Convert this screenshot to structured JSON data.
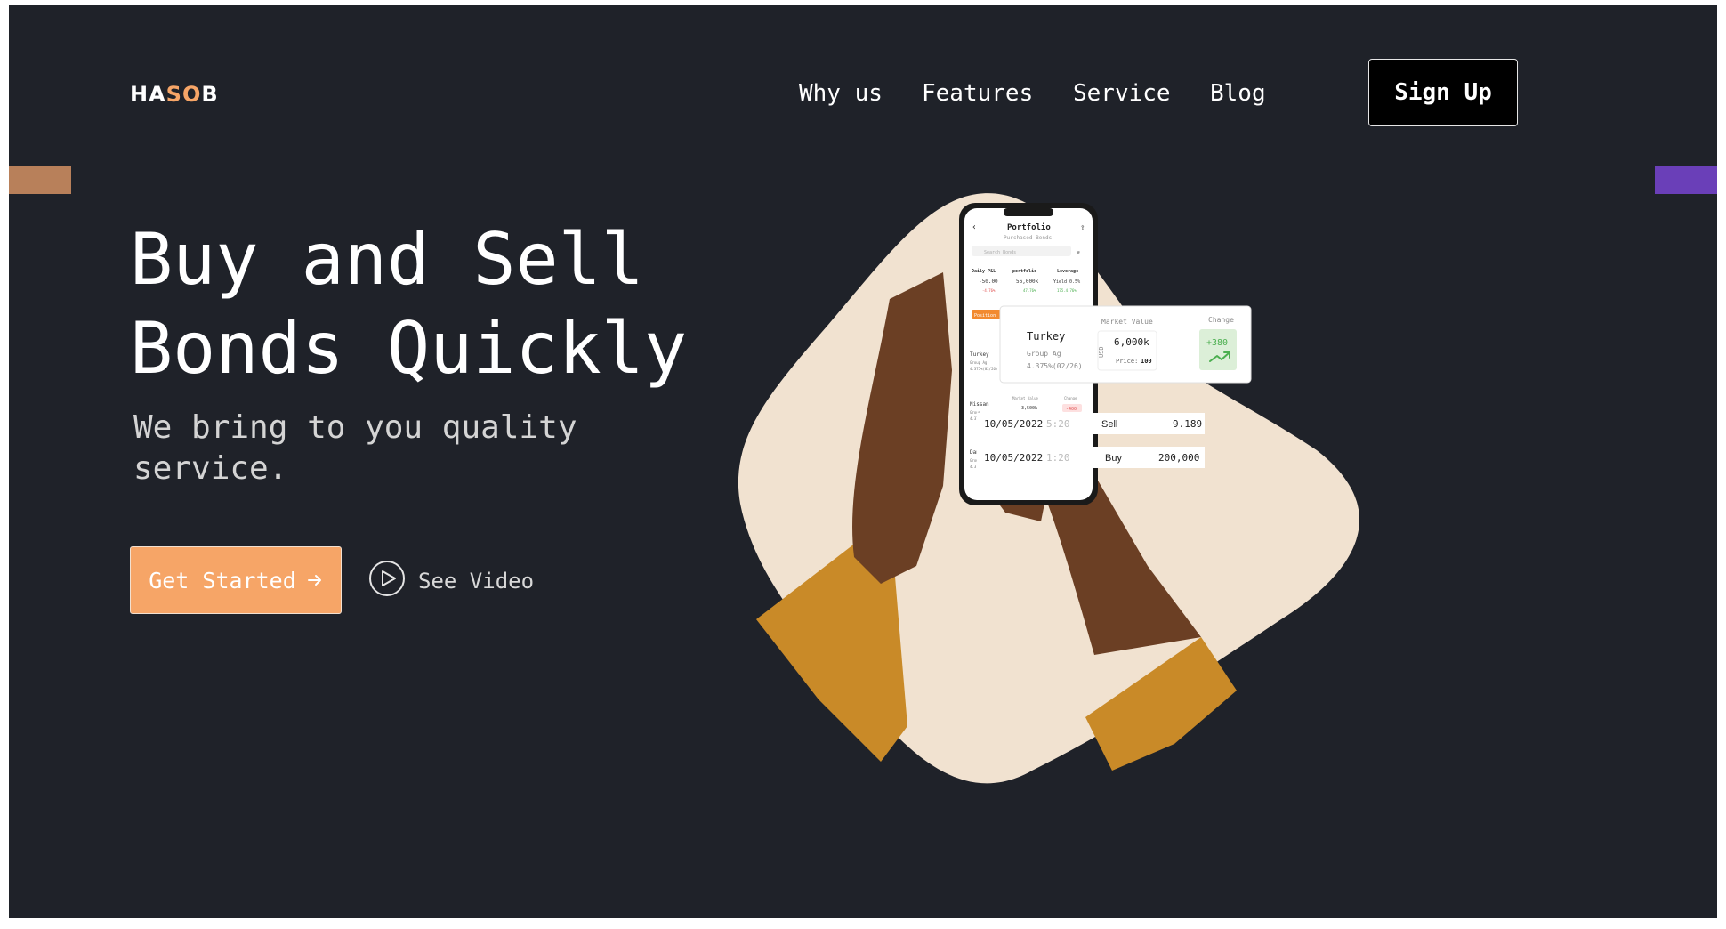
{
  "brand": {
    "logo_part1": "HA",
    "logo_part2": "SO",
    "logo_part3": "B"
  },
  "nav": {
    "items": [
      {
        "label": "Why us"
      },
      {
        "label": "Features"
      },
      {
        "label": "Service"
      },
      {
        "label": "Blog"
      }
    ],
    "signup_label": "Sign Up"
  },
  "hero": {
    "headline_line1": "Buy and Sell",
    "headline_line2": "Bonds Quickly",
    "subtitle": "We bring to you quality service.",
    "cta_label": "Get Started",
    "cta_icon": "arrow-right-icon",
    "video_label": "See Video",
    "video_icon": "play-circle-icon"
  },
  "phone": {
    "title": "Portfolio",
    "subtitle": "Purchased Bonds",
    "search_placeholder": "Search Bonds",
    "stats": [
      {
        "label": "Daily P&L",
        "value": "-50.00",
        "delta": "-4.76%"
      },
      {
        "label": "portfolio",
        "value": "56,000k",
        "delta": "47.76%"
      },
      {
        "label": "Leverage",
        "value": "Yield 0.5%",
        "delta": "175.4.76%"
      }
    ],
    "tab_label": "Position",
    "rows": [
      {
        "name": "Turkey",
        "detail": "Group Ag",
        "rate": "4.375%(02/26)"
      },
      {
        "name": "Nissan",
        "detail": "Group",
        "rate": "4.37",
        "value": "3,500k",
        "change": "-400"
      },
      {
        "name": "Dan",
        "detail": "Grou",
        "rate": "4.3"
      }
    ],
    "row_label_market": "Market Value",
    "row_label_change": "Change"
  },
  "popup": {
    "name": "Turkey",
    "group": "Group Ag",
    "rate": "4.375%(02/26)",
    "market_label": "Market Value",
    "currency": "USD",
    "market_value": "6,000k",
    "price_label": "Price:",
    "price_value": "100",
    "change_label": "Change",
    "change_value": "+380",
    "change_icon": "trending-up-icon"
  },
  "trades": [
    {
      "date": "10/05/2022",
      "time": "5:20",
      "side": "Sell",
      "amount": "9.189"
    },
    {
      "date": "10/05/2022",
      "time": "1:20",
      "side": "Buy",
      "amount": "200,000"
    }
  ],
  "colors": {
    "background": "#1f2229",
    "accent": "#f6a567",
    "deco_left": "#b8805a",
    "deco_right": "#6a3fb8",
    "blob": "#f1e2d0",
    "sleeve": "#c98a28",
    "skin": "#6b3f24",
    "positive": "#4caf50",
    "negative": "#e05050"
  }
}
